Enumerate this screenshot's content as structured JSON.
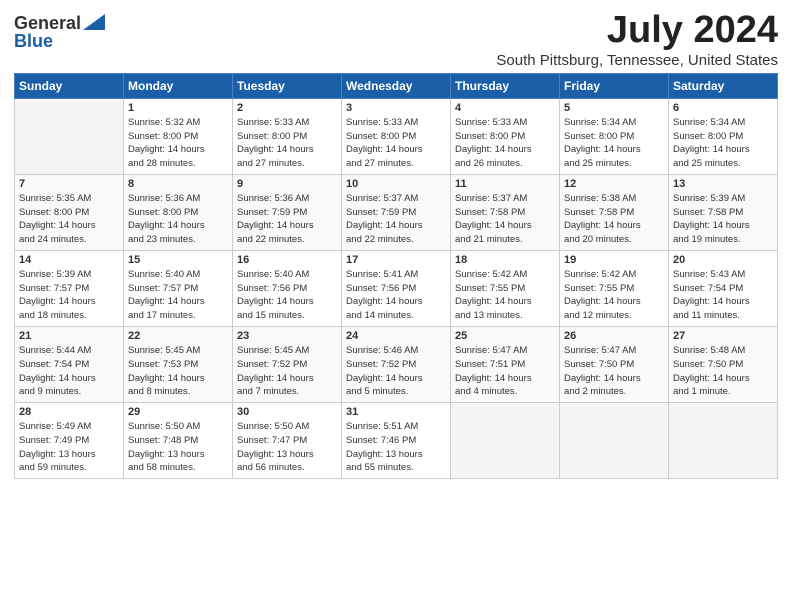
{
  "header": {
    "logo_general": "General",
    "logo_blue": "Blue",
    "month": "July 2024",
    "location": "South Pittsburg, Tennessee, United States"
  },
  "weekdays": [
    "Sunday",
    "Monday",
    "Tuesday",
    "Wednesday",
    "Thursday",
    "Friday",
    "Saturday"
  ],
  "weeks": [
    [
      {
        "day": "",
        "info": ""
      },
      {
        "day": "1",
        "info": "Sunrise: 5:32 AM\nSunset: 8:00 PM\nDaylight: 14 hours\nand 28 minutes."
      },
      {
        "day": "2",
        "info": "Sunrise: 5:33 AM\nSunset: 8:00 PM\nDaylight: 14 hours\nand 27 minutes."
      },
      {
        "day": "3",
        "info": "Sunrise: 5:33 AM\nSunset: 8:00 PM\nDaylight: 14 hours\nand 27 minutes."
      },
      {
        "day": "4",
        "info": "Sunrise: 5:33 AM\nSunset: 8:00 PM\nDaylight: 14 hours\nand 26 minutes."
      },
      {
        "day": "5",
        "info": "Sunrise: 5:34 AM\nSunset: 8:00 PM\nDaylight: 14 hours\nand 25 minutes."
      },
      {
        "day": "6",
        "info": "Sunrise: 5:34 AM\nSunset: 8:00 PM\nDaylight: 14 hours\nand 25 minutes."
      }
    ],
    [
      {
        "day": "7",
        "info": "Sunrise: 5:35 AM\nSunset: 8:00 PM\nDaylight: 14 hours\nand 24 minutes."
      },
      {
        "day": "8",
        "info": "Sunrise: 5:36 AM\nSunset: 8:00 PM\nDaylight: 14 hours\nand 23 minutes."
      },
      {
        "day": "9",
        "info": "Sunrise: 5:36 AM\nSunset: 7:59 PM\nDaylight: 14 hours\nand 22 minutes."
      },
      {
        "day": "10",
        "info": "Sunrise: 5:37 AM\nSunset: 7:59 PM\nDaylight: 14 hours\nand 22 minutes."
      },
      {
        "day": "11",
        "info": "Sunrise: 5:37 AM\nSunset: 7:58 PM\nDaylight: 14 hours\nand 21 minutes."
      },
      {
        "day": "12",
        "info": "Sunrise: 5:38 AM\nSunset: 7:58 PM\nDaylight: 14 hours\nand 20 minutes."
      },
      {
        "day": "13",
        "info": "Sunrise: 5:39 AM\nSunset: 7:58 PM\nDaylight: 14 hours\nand 19 minutes."
      }
    ],
    [
      {
        "day": "14",
        "info": "Sunrise: 5:39 AM\nSunset: 7:57 PM\nDaylight: 14 hours\nand 18 minutes."
      },
      {
        "day": "15",
        "info": "Sunrise: 5:40 AM\nSunset: 7:57 PM\nDaylight: 14 hours\nand 17 minutes."
      },
      {
        "day": "16",
        "info": "Sunrise: 5:40 AM\nSunset: 7:56 PM\nDaylight: 14 hours\nand 15 minutes."
      },
      {
        "day": "17",
        "info": "Sunrise: 5:41 AM\nSunset: 7:56 PM\nDaylight: 14 hours\nand 14 minutes."
      },
      {
        "day": "18",
        "info": "Sunrise: 5:42 AM\nSunset: 7:55 PM\nDaylight: 14 hours\nand 13 minutes."
      },
      {
        "day": "19",
        "info": "Sunrise: 5:42 AM\nSunset: 7:55 PM\nDaylight: 14 hours\nand 12 minutes."
      },
      {
        "day": "20",
        "info": "Sunrise: 5:43 AM\nSunset: 7:54 PM\nDaylight: 14 hours\nand 11 minutes."
      }
    ],
    [
      {
        "day": "21",
        "info": "Sunrise: 5:44 AM\nSunset: 7:54 PM\nDaylight: 14 hours\nand 9 minutes."
      },
      {
        "day": "22",
        "info": "Sunrise: 5:45 AM\nSunset: 7:53 PM\nDaylight: 14 hours\nand 8 minutes."
      },
      {
        "day": "23",
        "info": "Sunrise: 5:45 AM\nSunset: 7:52 PM\nDaylight: 14 hours\nand 7 minutes."
      },
      {
        "day": "24",
        "info": "Sunrise: 5:46 AM\nSunset: 7:52 PM\nDaylight: 14 hours\nand 5 minutes."
      },
      {
        "day": "25",
        "info": "Sunrise: 5:47 AM\nSunset: 7:51 PM\nDaylight: 14 hours\nand 4 minutes."
      },
      {
        "day": "26",
        "info": "Sunrise: 5:47 AM\nSunset: 7:50 PM\nDaylight: 14 hours\nand 2 minutes."
      },
      {
        "day": "27",
        "info": "Sunrise: 5:48 AM\nSunset: 7:50 PM\nDaylight: 14 hours\nand 1 minute."
      }
    ],
    [
      {
        "day": "28",
        "info": "Sunrise: 5:49 AM\nSunset: 7:49 PM\nDaylight: 13 hours\nand 59 minutes."
      },
      {
        "day": "29",
        "info": "Sunrise: 5:50 AM\nSunset: 7:48 PM\nDaylight: 13 hours\nand 58 minutes."
      },
      {
        "day": "30",
        "info": "Sunrise: 5:50 AM\nSunset: 7:47 PM\nDaylight: 13 hours\nand 56 minutes."
      },
      {
        "day": "31",
        "info": "Sunrise: 5:51 AM\nSunset: 7:46 PM\nDaylight: 13 hours\nand 55 minutes."
      },
      {
        "day": "",
        "info": ""
      },
      {
        "day": "",
        "info": ""
      },
      {
        "day": "",
        "info": ""
      }
    ]
  ]
}
